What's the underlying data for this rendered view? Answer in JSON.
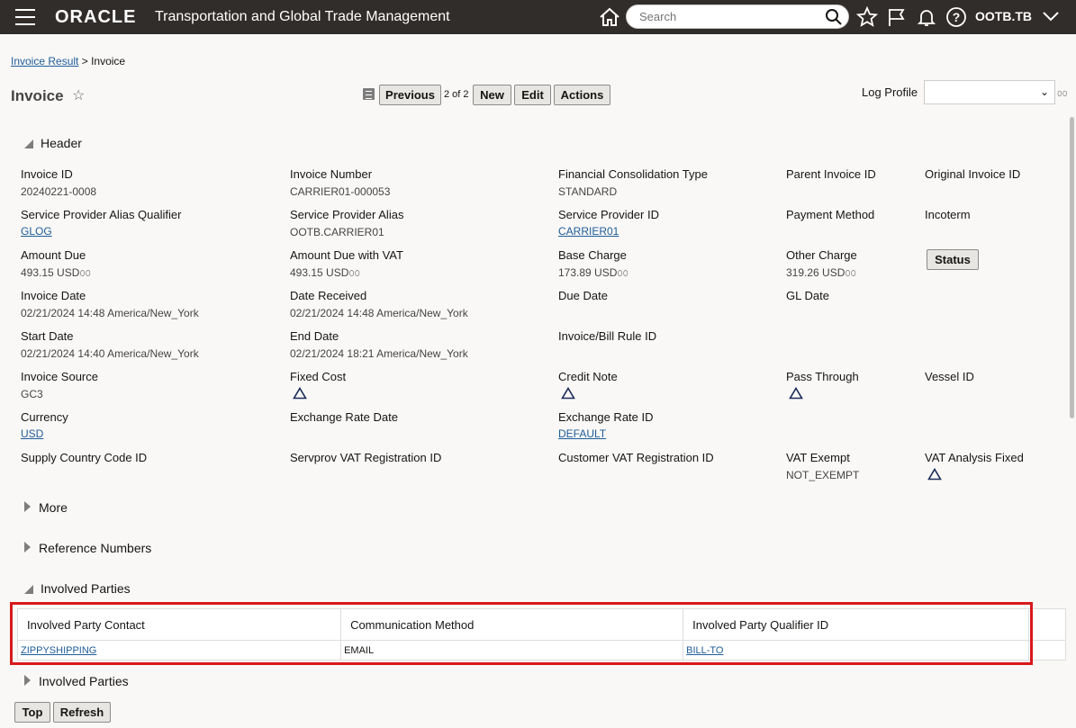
{
  "topbar": {
    "logo": "ORACLE",
    "app_title": "Transportation and Global Trade Management",
    "search_placeholder": "Search",
    "user": "OOTB.TB"
  },
  "breadcrumb": {
    "link": "Invoice Result",
    "separator": ">",
    "current": "Invoice"
  },
  "page": {
    "title": "Invoice",
    "star": "☆"
  },
  "toolbar": {
    "previous": "Previous",
    "page_count": "2 of 2",
    "new": "New",
    "edit": "Edit",
    "actions": "Actions",
    "log_profile_label": "Log Profile",
    "log_profile_value": ""
  },
  "header_section": {
    "title": "Header"
  },
  "fields": {
    "invoice_id": {
      "label": "Invoice ID",
      "value": "20240221-0008"
    },
    "invoice_number": {
      "label": "Invoice Number",
      "value": "CARRIER01-000053"
    },
    "fin_consolidation_type": {
      "label": "Financial Consolidation Type",
      "value": "STANDARD"
    },
    "parent_invoice_id": {
      "label": "Parent Invoice ID",
      "value": ""
    },
    "original_invoice_id": {
      "label": "Original Invoice ID",
      "value": ""
    },
    "sp_alias_qualifier": {
      "label": "Service Provider Alias Qualifier",
      "value": "GLOG"
    },
    "sp_alias": {
      "label": "Service Provider Alias",
      "value": "OOTB.CARRIER01"
    },
    "sp_id": {
      "label": "Service Provider ID",
      "value": "CARRIER01"
    },
    "payment_method": {
      "label": "Payment Method",
      "value": ""
    },
    "incoterm": {
      "label": "Incoterm",
      "value": ""
    },
    "amount_due": {
      "label": "Amount Due",
      "value": "493.15 USD"
    },
    "amount_due_vat": {
      "label": "Amount Due with VAT",
      "value": "493.15 USD"
    },
    "base_charge": {
      "label": "Base Charge",
      "value": "173.89 USD"
    },
    "other_charge": {
      "label": "Other Charge",
      "value": "319.26 USD"
    },
    "status_button": "Status",
    "invoice_date": {
      "label": "Invoice Date",
      "value": "02/21/2024 14:48 America/New_York"
    },
    "date_received": {
      "label": "Date Received",
      "value": "02/21/2024 14:48 America/New_York"
    },
    "due_date": {
      "label": "Due Date",
      "value": ""
    },
    "gl_date": {
      "label": "GL Date",
      "value": ""
    },
    "start_date": {
      "label": "Start Date",
      "value": "02/21/2024 14:40 America/New_York"
    },
    "end_date": {
      "label": "End Date",
      "value": "02/21/2024 18:21 America/New_York"
    },
    "bill_rule_id": {
      "label": "Invoice/Bill Rule ID",
      "value": ""
    },
    "invoice_source": {
      "label": "Invoice Source",
      "value": "GC3"
    },
    "fixed_cost": {
      "label": "Fixed Cost"
    },
    "credit_note": {
      "label": "Credit Note"
    },
    "pass_through": {
      "label": "Pass Through"
    },
    "vessel_id": {
      "label": "Vessel ID",
      "value": ""
    },
    "currency": {
      "label": "Currency",
      "value": "USD"
    },
    "exchange_rate_date": {
      "label": "Exchange Rate Date",
      "value": ""
    },
    "exchange_rate_id": {
      "label": "Exchange Rate ID",
      "value": "DEFAULT"
    },
    "supply_country": {
      "label": "Supply Country Code ID",
      "value": ""
    },
    "servprov_vat": {
      "label": "Servprov VAT Registration ID",
      "value": ""
    },
    "customer_vat": {
      "label": "Customer VAT Registration ID",
      "value": ""
    },
    "vat_exempt": {
      "label": "VAT Exempt",
      "value": "NOT_EXEMPT"
    },
    "vat_analysis_fixed": {
      "label": "VAT Analysis Fixed"
    }
  },
  "sections": {
    "more": "More",
    "reference_numbers": "Reference Numbers",
    "involved_parties": "Involved Parties",
    "involved_parties_2": "Involved Parties"
  },
  "involved_table": {
    "headers": [
      "Involved Party Contact",
      "Communication Method",
      "Involved Party Qualifier ID"
    ],
    "rows": [
      {
        "contact": "ZIPPYSHIPPING",
        "method": "EMAIL",
        "qualifier": "BILL-TO"
      }
    ]
  },
  "bottom": {
    "top": "Top",
    "refresh": "Refresh"
  },
  "colors": {
    "topbar": "#312d2a",
    "link": "#1f5c99",
    "highlight": "#d7191c"
  }
}
